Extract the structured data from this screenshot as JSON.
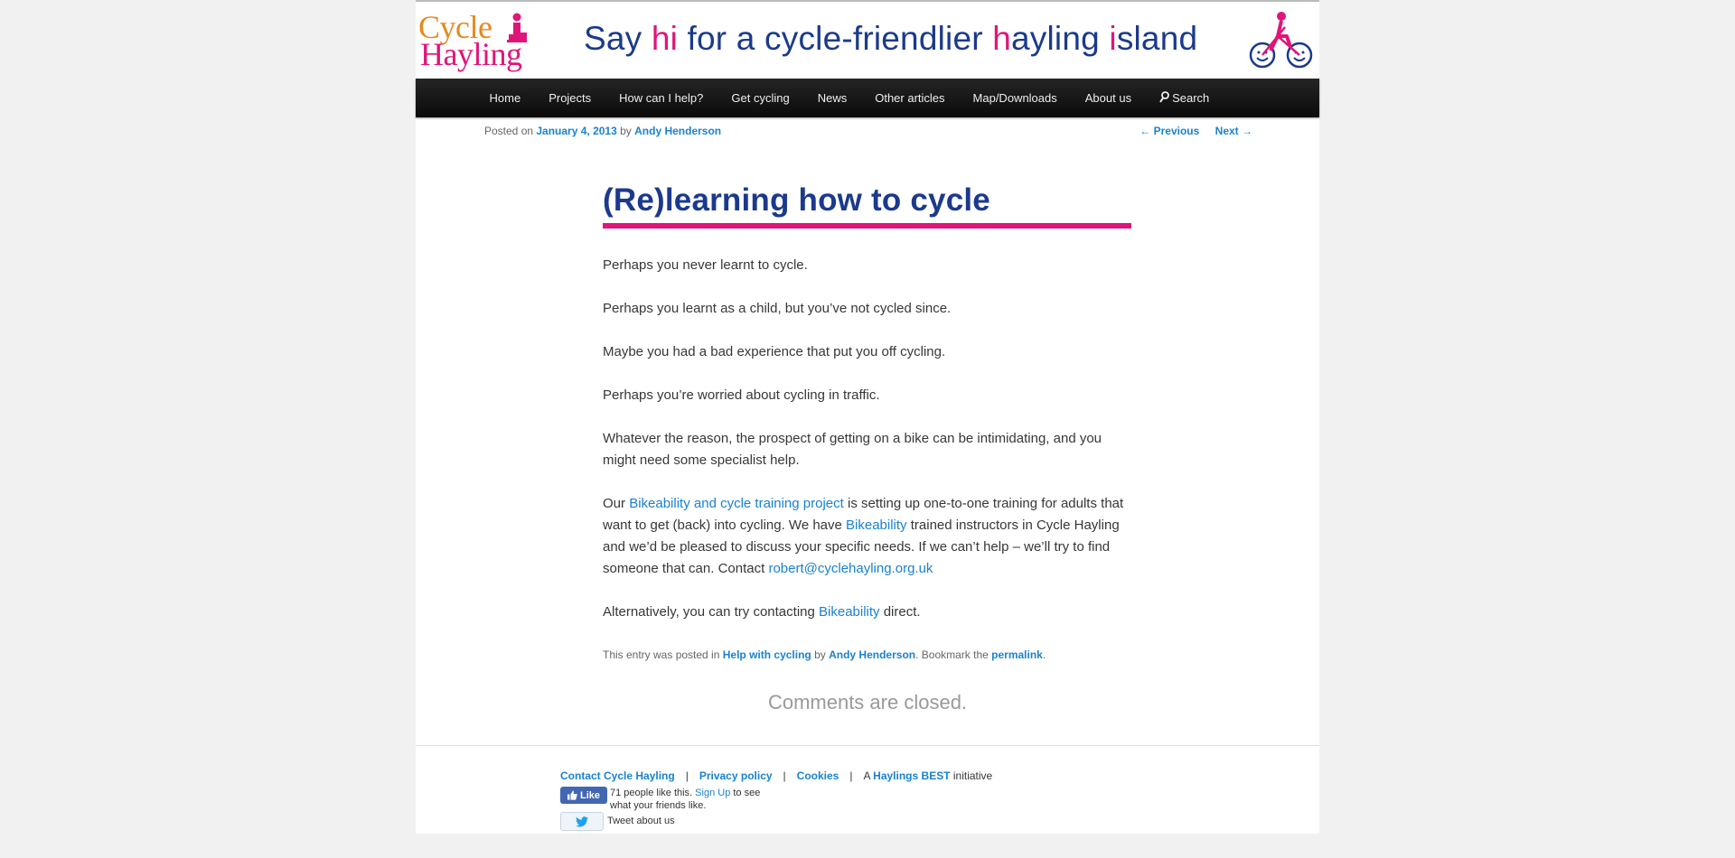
{
  "header": {
    "logo_line1": "Cycle",
    "logo_line2": "Hayling",
    "tagline": {
      "p1": "Say ",
      "h1": "hi",
      "p2": " for a cycle-friendlier ",
      "h2": "h",
      "p3": "ayling ",
      "h3": "i",
      "p4": "sland"
    }
  },
  "nav": {
    "items": [
      "Home",
      "Projects",
      "How can I help?",
      "Get cycling",
      "News",
      "Other articles",
      "Map/Downloads",
      "About us"
    ],
    "search_label": "Search"
  },
  "meta": {
    "posted_on": "Posted on ",
    "date": "January 4, 2013",
    "by": " by ",
    "author": "Andy Henderson"
  },
  "nav_single": {
    "previous": "← Previous",
    "next": "Next →"
  },
  "article": {
    "title": "(Re)learning how to cycle",
    "p1": "Perhaps you never learnt to cycle.",
    "p2": "Perhaps you learnt as a child, but you’ve not cycled since.",
    "p3": "Maybe you had a bad experience that put you off cycling.",
    "p4": "Perhaps you’re worried about cycling in traffic.",
    "p5": "Whatever the reason, the prospect of getting on a bike can be intimidating, and you might need some specialist help.",
    "p6": {
      "t1": "Our ",
      "link1": "Bikeability and cycle training project",
      "t2": " is setting up one-to-one training for adults that want to get (back) into cycling.  We have ",
      "link2": "Bikeability",
      "t3": " trained instructors in Cycle Hayling and we’d be pleased to discuss your specific needs.  If we can’t help – we’ll try to find someone that can.  Contact ",
      "email": "robert@cyclehayling.org.uk"
    },
    "p7": {
      "t1": "Alternatively, you can try contacting ",
      "link": "Bikeability",
      "t2": " direct."
    }
  },
  "entry_footer": {
    "t1": "This entry was posted in ",
    "category": "Help with cycling",
    "t2": " by ",
    "author": "Andy Henderson",
    "t3": ". Bookmark the ",
    "permalink": "permalink",
    "t4": "."
  },
  "comments_closed": "Comments are closed.",
  "footer": {
    "contact": "Contact Cycle Hayling",
    "privacy": "Privacy policy",
    "cookies": "Cookies",
    "sep": "|",
    "a": "A ",
    "best": "Haylings BEST",
    "initiative": " initiative",
    "fb_like": "Like",
    "fb_count_text": "71 people like this. ",
    "fb_signup": "Sign Up",
    "fb_rest": " to see what your friends like.",
    "tweet": "Tweet about us"
  },
  "colors": {
    "brand_blue": "#1b3a8c",
    "brand_pink": "#e0157a",
    "logo_orange": "#e58a1f",
    "link": "#1982d1"
  }
}
